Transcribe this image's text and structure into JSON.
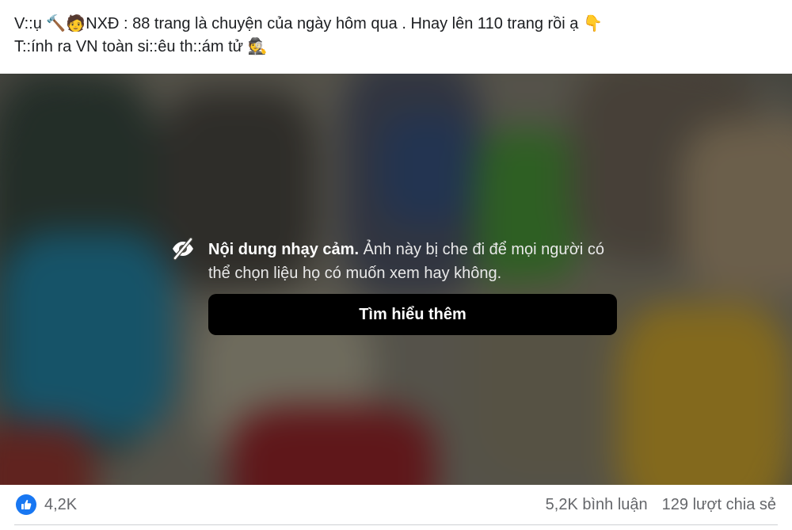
{
  "post": {
    "line1": "V::ụ 🔨🧑NXĐ : 88 trang là chuyện của ngày hôm qua . Hnay lên 110 trang rồi ạ 👇",
    "line2": "T::ính ra VN toàn si::êu th::ám tử 🕵️"
  },
  "sensitive": {
    "icon": "eye-slash-icon",
    "title": "Nội dung nhạy cảm.",
    "message": " Ảnh này bị che đi để mọi người có thể chọn liệu họ có muốn xem hay không.",
    "button_label": "Tìm hiểu thêm"
  },
  "stats": {
    "reaction_icon": "like-icon",
    "reaction_count": "4,2K",
    "comments": "5,2K bình luận",
    "shares": "129 lượt chia sẻ"
  },
  "colors": {
    "like_blue": "#1877f2",
    "muted_text": "#65676b"
  }
}
